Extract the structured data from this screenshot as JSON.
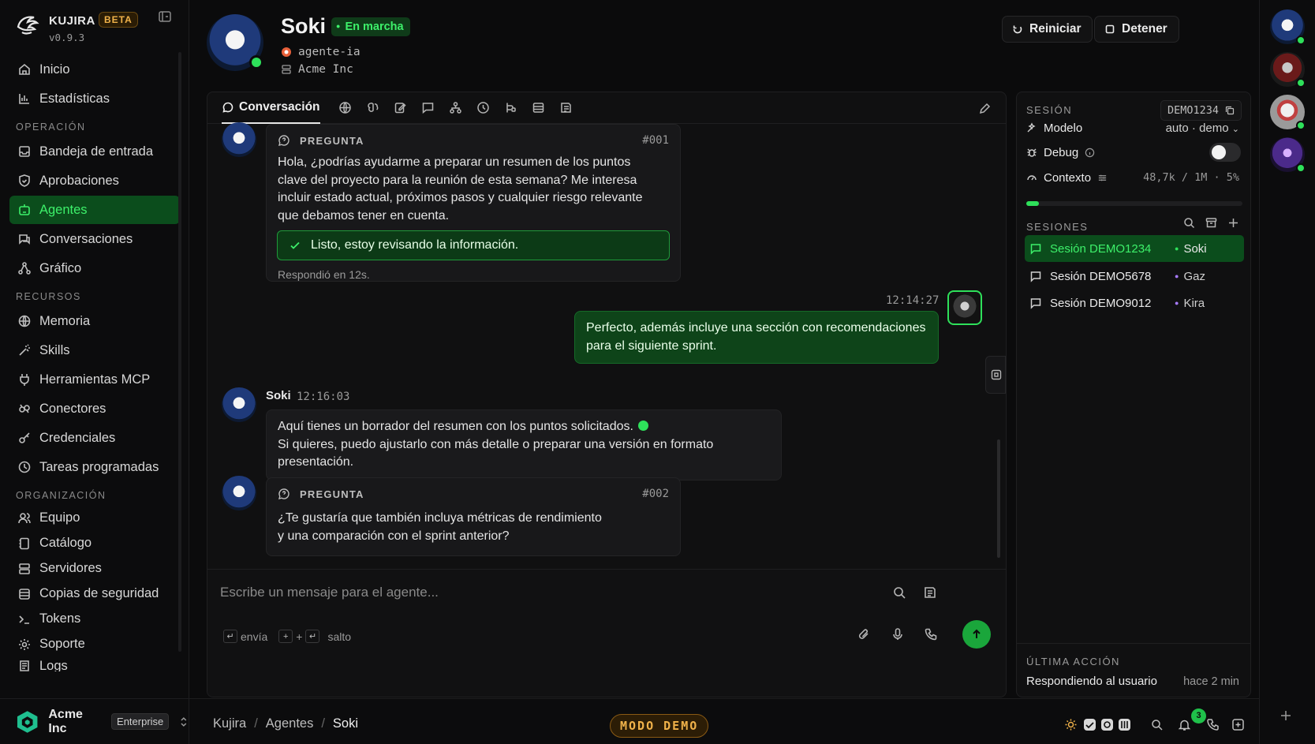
{
  "brand": {
    "name": "KUJIRA",
    "badge": "BETA",
    "version": "v0.9.3"
  },
  "nav": {
    "items_top": [
      {
        "label": "Inicio",
        "icon": "home-icon"
      },
      {
        "label": "Estadísticas",
        "icon": "stats-icon"
      }
    ],
    "section_operacion": "OPERACIÓN",
    "items_operacion": [
      {
        "label": "Bandeja de entrada",
        "icon": "inbox-icon"
      },
      {
        "label": "Aprobaciones",
        "icon": "shield-icon"
      },
      {
        "label": "Agentes",
        "icon": "bot-icon",
        "active": true
      },
      {
        "label": "Conversaciones",
        "icon": "chat-icon"
      },
      {
        "label": "Gráfico",
        "icon": "graph-icon"
      }
    ],
    "section_recursos": "RECURSOS",
    "items_recursos": [
      {
        "label": "Memoria",
        "icon": "globe-icon"
      },
      {
        "label": "Skills",
        "icon": "wand-icon"
      },
      {
        "label": "Herramientas MCP",
        "icon": "plug-icon"
      },
      {
        "label": "Conectores",
        "icon": "link-icon"
      },
      {
        "label": "Credenciales",
        "icon": "key-icon"
      },
      {
        "label": "Tareas programadas",
        "icon": "clock-icon"
      }
    ],
    "section_organizacion": "ORGANIZACIÓN",
    "items_organizacion": [
      {
        "label": "Equipo",
        "icon": "team-icon"
      },
      {
        "label": "Catálogo",
        "icon": "catalog-icon"
      },
      {
        "label": "Servidores",
        "icon": "server-icon"
      },
      {
        "label": "Copias de seguridad",
        "icon": "database-icon"
      },
      {
        "label": "Tokens",
        "icon": "terminal-icon"
      },
      {
        "label": "Soporte",
        "icon": "gear-icon"
      },
      {
        "label": "Logs",
        "icon": "logs-icon"
      }
    ]
  },
  "workspace": {
    "name": "Acme Inc",
    "plan": "Enterprise"
  },
  "header": {
    "agent_name": "Soki",
    "status": "En marcha",
    "handle": "agente-ia",
    "org": "Acme Inc",
    "restart_label": "Reiniciar",
    "stop_label": "Detener"
  },
  "tabs": {
    "active_label": "Conversación"
  },
  "messages": {
    "q1": {
      "tag": "PREGUNTA",
      "number": "#001",
      "text": "Hola, ¿podrías ayudarme a preparar un resumen de los puntos\nclave del proyecto para la reunión de esta semana? Me interesa\nincluir estado actual, próximos pasos y cualquier riesgo relevante\nque debamos tener en cuenta.",
      "done": "Listo, estoy revisando la información.",
      "replied": "Respondió en 12s."
    },
    "user": {
      "time": "12:14:27",
      "text": "Perfecto, además incluye una sección con recomendaciones\npara el siguiente sprint."
    },
    "agent": {
      "name": "Soki",
      "time": "12:16:03",
      "line1": "Aquí tienes un borrador del resumen con los puntos solicitados.",
      "line2": "Si quieres, puedo ajustarlo con más detalle o preparar una versión en formato presentación."
    },
    "q2": {
      "tag": "PREGUNTA",
      "number": "#002",
      "text": "¿Te gustaría que también incluya métricas de rendimiento\ny una comparación con el sprint anterior?"
    }
  },
  "composer": {
    "placeholder": "Escribe un mensaje para el agente...",
    "hint_send": "envía",
    "hint_plus": "+",
    "hint_newline": "salto"
  },
  "panel": {
    "session_label": "SESIÓN",
    "session_id": "DEMO1234",
    "model_label": "Modelo",
    "model_value": "auto · demo",
    "debug_label": "Debug",
    "debug_on": false,
    "context_label": "Contexto",
    "context_value": "48,7k / 1M · 5%",
    "context_fraction": 0.05,
    "sessions_label": "SESIONES",
    "sessions": [
      {
        "title": "Sesión DEMO1234",
        "agent": "Soki",
        "color": "#2ee05a",
        "active": true
      },
      {
        "title": "Sesión DEMO5678",
        "agent": "Gaz",
        "color": "#a77bff",
        "active": false
      },
      {
        "title": "Sesión DEMO9012",
        "agent": "Kira",
        "color": "#a77bff",
        "active": false
      }
    ],
    "last_action_label": "ÚLTIMA ACCIÓN",
    "last_action": "Respondiendo al usuario",
    "last_action_time": "hace 2 min"
  },
  "bottombar": {
    "crumbs": [
      "Kujira",
      "Agentes",
      "Soki"
    ],
    "demo_label": "MODO DEMO",
    "notifications": "3"
  },
  "colors": {
    "accent": "#2ee05a",
    "accent_dark": "#0b4d1c",
    "demo": "#f0b24a"
  }
}
